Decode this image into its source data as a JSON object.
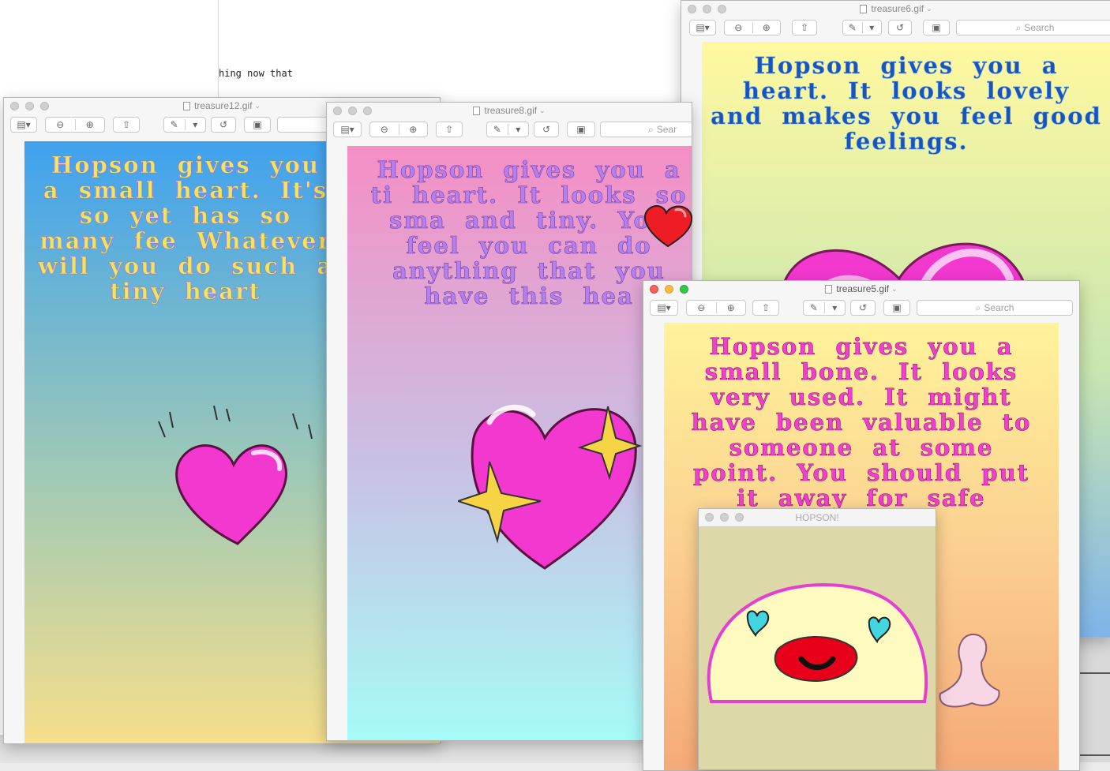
{
  "background_doc": {
    "text": "hing now that"
  },
  "windows": {
    "treasure6": {
      "title": "treasure6.gif",
      "search_label": "Search",
      "card_text": "Hopson gives you a heart. It looks lovely and makes you feel good feelings.",
      "text_color": "#1b54b8",
      "gradient": [
        "#fff8a0",
        "#c8e6b0",
        "#7fb4ea"
      ]
    },
    "treasure12": {
      "title": "treasure12.gif",
      "card_text": "Hopson gives you a small heart. It's so yet has so many fee Whatever will you do such a tiny heart",
      "text_color": "#f1e55a",
      "gradient": [
        "#3fa2ee",
        "#9fc9b6",
        "#f7de8a"
      ]
    },
    "treasure8": {
      "title": "treasure8.gif",
      "search_label": "Sear",
      "card_text": "Hopson gives you a ti heart. It looks so sma and tiny. You feel you can do anything that you have this hea",
      "text_color": "#b67ff0",
      "gradient": [
        "#f58ec4",
        "#c8c2e4",
        "#a6fbf7"
      ]
    },
    "treasure5": {
      "title": "treasure5.gif",
      "search_label": "Search",
      "card_text": "Hopson gives you a small bone. It looks very used. It might have been valuable to someone at some point. You should put it away for safe keeping.",
      "text_color": "#f23fd0",
      "gradient": [
        "#fff39a",
        "#fbd090",
        "#f5aa78"
      ]
    },
    "hopson": {
      "title": "HOPSON!",
      "face_color": "#fffbc0",
      "outline_color": "#e33fd0",
      "eye_color": "#44d6e0",
      "mouth_color": "#e8001a"
    }
  },
  "colors": {
    "heart_pink": "#f238cf",
    "sparkle": "#f6d444",
    "red_heart": "#ee1c25"
  }
}
